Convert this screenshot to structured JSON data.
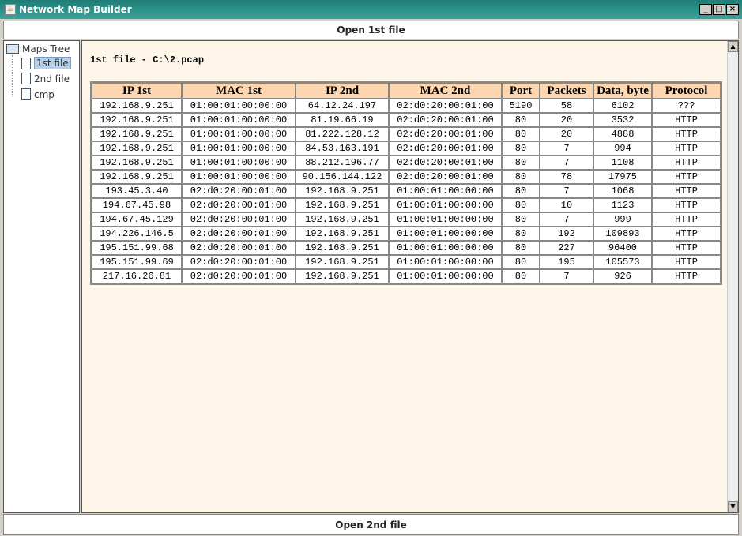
{
  "window": {
    "title": "Network Map Builder",
    "controls": [
      "_",
      "□",
      "×"
    ]
  },
  "buttons": {
    "open1": "Open 1st file",
    "open2": "Open 2nd file"
  },
  "tree": {
    "root": "Maps Tree",
    "items": [
      "1st file",
      "2nd file",
      "cmp"
    ],
    "selected": 0
  },
  "file_info": "1st file - C:\\2.pcap",
  "table": {
    "headers": [
      "IP 1st",
      "MAC 1st",
      "IP 2nd",
      "MAC 2nd",
      "Port",
      "Packets",
      "Data, byte",
      "Protocol"
    ],
    "rows": [
      [
        "192.168.9.251",
        "01:00:01:00:00:00",
        "64.12.24.197",
        "02:d0:20:00:01:00",
        "5190",
        "58",
        "6102",
        "???"
      ],
      [
        "192.168.9.251",
        "01:00:01:00:00:00",
        "81.19.66.19",
        "02:d0:20:00:01:00",
        "80",
        "20",
        "3532",
        "HTTP"
      ],
      [
        "192.168.9.251",
        "01:00:01:00:00:00",
        "81.222.128.12",
        "02:d0:20:00:01:00",
        "80",
        "20",
        "4888",
        "HTTP"
      ],
      [
        "192.168.9.251",
        "01:00:01:00:00:00",
        "84.53.163.191",
        "02:d0:20:00:01:00",
        "80",
        "7",
        "994",
        "HTTP"
      ],
      [
        "192.168.9.251",
        "01:00:01:00:00:00",
        "88.212.196.77",
        "02:d0:20:00:01:00",
        "80",
        "7",
        "1108",
        "HTTP"
      ],
      [
        "192.168.9.251",
        "01:00:01:00:00:00",
        "90.156.144.122",
        "02:d0:20:00:01:00",
        "80",
        "78",
        "17975",
        "HTTP"
      ],
      [
        "193.45.3.40",
        "02:d0:20:00:01:00",
        "192.168.9.251",
        "01:00:01:00:00:00",
        "80",
        "7",
        "1068",
        "HTTP"
      ],
      [
        "194.67.45.98",
        "02:d0:20:00:01:00",
        "192.168.9.251",
        "01:00:01:00:00:00",
        "80",
        "10",
        "1123",
        "HTTP"
      ],
      [
        "194.67.45.129",
        "02:d0:20:00:01:00",
        "192.168.9.251",
        "01:00:01:00:00:00",
        "80",
        "7",
        "999",
        "HTTP"
      ],
      [
        "194.226.146.5",
        "02:d0:20:00:01:00",
        "192.168.9.251",
        "01:00:01:00:00:00",
        "80",
        "192",
        "109893",
        "HTTP"
      ],
      [
        "195.151.99.68",
        "02:d0:20:00:01:00",
        "192.168.9.251",
        "01:00:01:00:00:00",
        "80",
        "227",
        "96400",
        "HTTP"
      ],
      [
        "195.151.99.69",
        "02:d0:20:00:01:00",
        "192.168.9.251",
        "01:00:01:00:00:00",
        "80",
        "195",
        "105573",
        "HTTP"
      ],
      [
        "217.16.26.81",
        "02:d0:20:00:01:00",
        "192.168.9.251",
        "01:00:01:00:00:00",
        "80",
        "7",
        "926",
        "HTTP"
      ]
    ]
  }
}
